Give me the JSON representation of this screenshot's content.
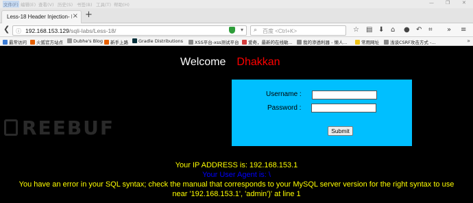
{
  "menubar": {
    "items": [
      "文件(F)",
      "编辑(E)",
      "查看(V)",
      "历史(S)",
      "书签(B)",
      "工具(T)",
      "帮助(H)"
    ]
  },
  "tab": {
    "title": "Less-18 Header Injection- E..."
  },
  "address": {
    "host": "192.168.153.129",
    "path": "/sqli-labs/Less-18/"
  },
  "search": {
    "engine_label": "百度",
    "placeholder": "<Ctrl+K>"
  },
  "bookmarks": [
    {
      "label": "最常访问",
      "color": "#3b7bd4"
    },
    {
      "label": "火狐官方站点",
      "color": "#e66000"
    },
    {
      "label": "Dubhe's Blog",
      "color": "#999999"
    },
    {
      "label": "新手上路",
      "color": "#e66000"
    },
    {
      "label": "Gradle Distributions",
      "color": "#02303a"
    },
    {
      "label": "XSS平台-xss测试平台",
      "color": "#888888"
    },
    {
      "label": "爱奇，最新的在线敏...",
      "color": "#d23c3c"
    },
    {
      "label": "我的渗透利器 - 懒人...",
      "color": "#888888"
    },
    {
      "label": "常用网址",
      "color": "#f0c419"
    },
    {
      "label": "浅谈CSRF攻击方式 -...",
      "color": "#888888"
    }
  ],
  "page": {
    "welcome": "Welcome",
    "name": "Dhakkan",
    "username_label": "Username :",
    "password_label": "Password :",
    "submit_label": "Submit",
    "ip_line": "Your IP ADDRESS is: 192.168.153.1",
    "agent_line": "Your User Agent is: \\",
    "error_line1": "You have an error in your SQL syntax; check the manual that corresponds to your MySQL server version for the right syntax to use",
    "error_line2": "near '192.168.153.1', 'admin')' at line 1"
  },
  "watermark": "REEBUF",
  "colors": {
    "box": "#00bfff",
    "name": "#ff0000",
    "message": "#ffff00",
    "agent": "#0000ff"
  }
}
